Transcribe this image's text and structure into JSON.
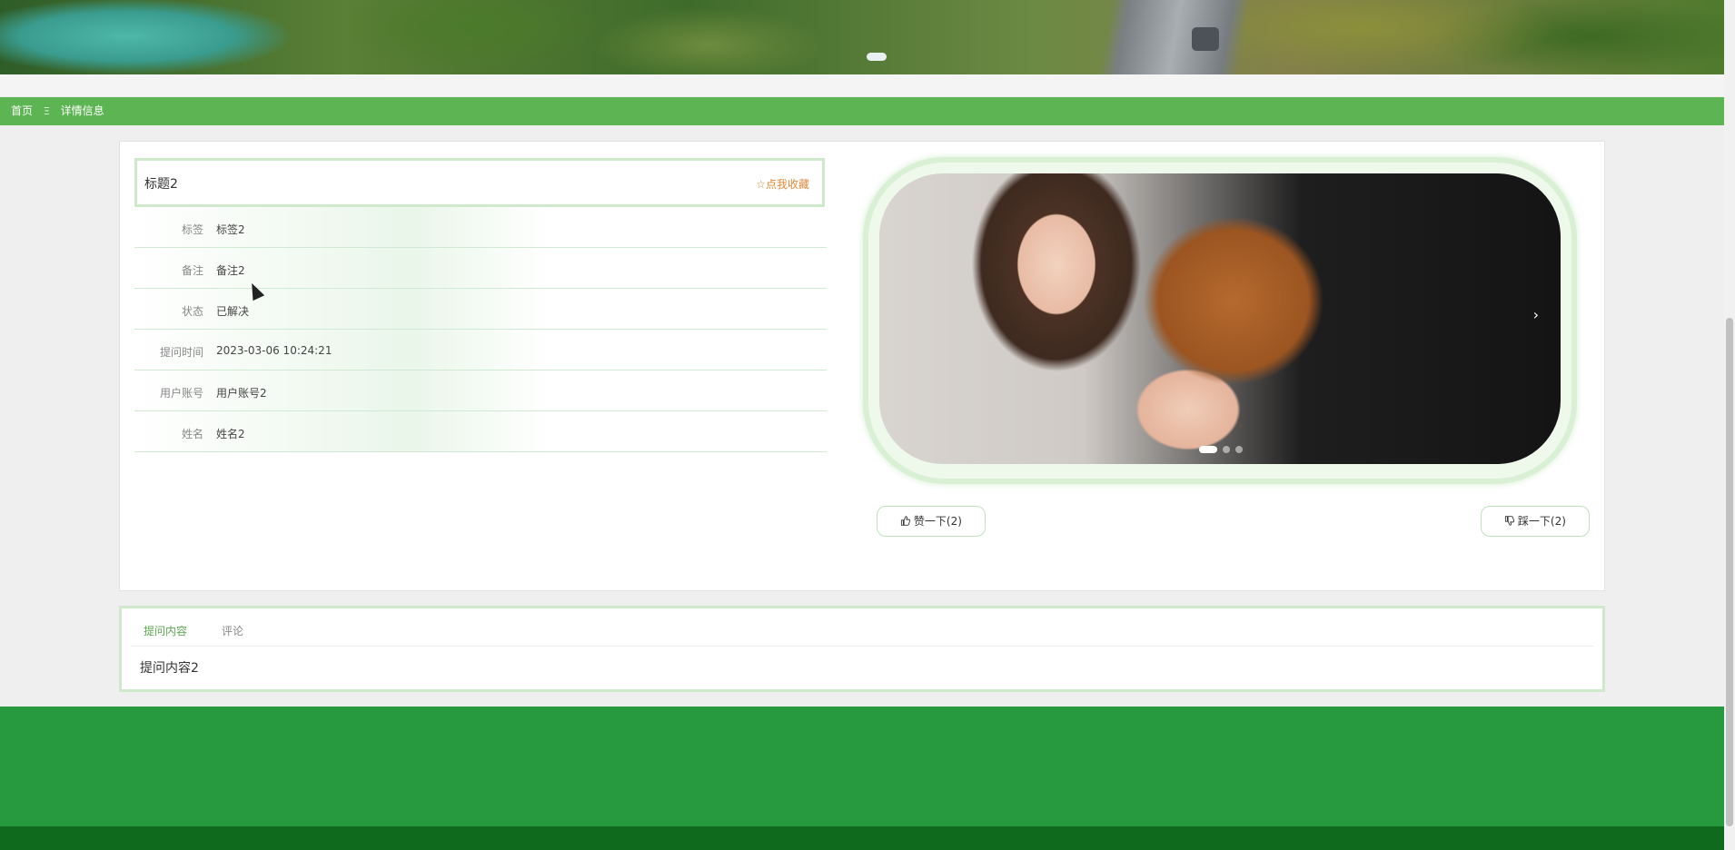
{
  "breadcrumb": {
    "home": "首页",
    "separator": "Ξ",
    "current": "详情信息"
  },
  "detail": {
    "title": "标题2",
    "favorite_label": "☆点我收藏",
    "fields": [
      {
        "label": "标签",
        "value": "标签2"
      },
      {
        "label": "备注",
        "value": "备注2"
      },
      {
        "label": "状态",
        "value": "已解决"
      },
      {
        "label": "提问时间",
        "value": "2023-03-06 10:24:21"
      },
      {
        "label": "用户账号",
        "value": "用户账号2"
      },
      {
        "label": "姓名",
        "value": "姓名2"
      }
    ]
  },
  "carousel": {
    "next_arrow": "›",
    "dot_count": 3,
    "active_index": 0
  },
  "votes": {
    "like_label": "赞一下(2)",
    "dislike_label": "踩一下(2)",
    "like_icon": "thumbs-up-icon",
    "dislike_icon": "thumbs-down-icon"
  },
  "tabs": [
    {
      "label": "提问内容",
      "active": true
    },
    {
      "label": "评论",
      "active": false
    }
  ],
  "tab_content": "提问内容2",
  "colors": {
    "accent_green": "#5cb552",
    "footer_green": "#27993f",
    "footer_dark": "#0f6a1d",
    "favorite_orange": "#e08a3b"
  }
}
